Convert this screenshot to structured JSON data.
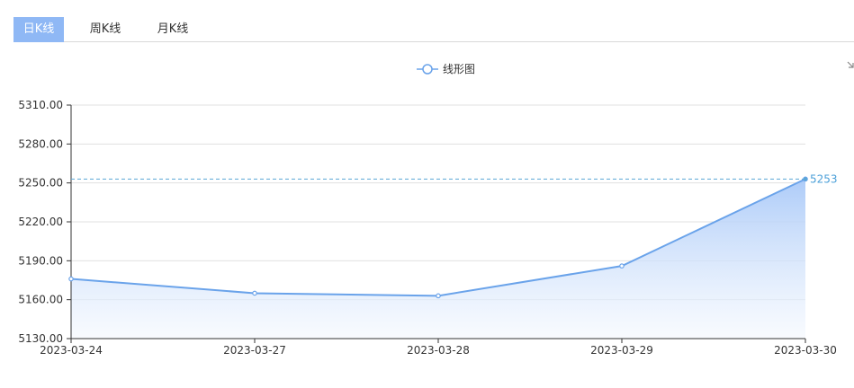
{
  "tabs": [
    {
      "label": "日K线",
      "active": true
    },
    {
      "label": "周K线",
      "active": false
    },
    {
      "label": "月K线",
      "active": false
    }
  ],
  "colors": {
    "line": "#6aa3ea",
    "area_top": "#a9c9f8",
    "area_bottom": "#f4f8fe",
    "markline": "#5ba7d6",
    "active_tab": "#8fb8f5",
    "grid": "#e0e0e0"
  },
  "icons": {
    "corner": "expand-icon"
  },
  "chart_data": {
    "type": "area",
    "title": "",
    "xlabel": "",
    "ylabel": "",
    "legend": [
      "线形图"
    ],
    "legend_position": "top-center",
    "grid": true,
    "categories": [
      "2023-03-24",
      "2023-03-27",
      "2023-03-28",
      "2023-03-29",
      "2023-03-30"
    ],
    "series": [
      {
        "name": "线形图",
        "values": [
          5176,
          5165,
          5163,
          5186,
          5253
        ]
      }
    ],
    "ylim": [
      5130,
      5310
    ],
    "yticks": [
      "5130.00",
      "5160.00",
      "5190.00",
      "5220.00",
      "5250.00",
      "5280.00",
      "5310.00"
    ],
    "markline": {
      "value": 5253,
      "label": "5253"
    }
  }
}
